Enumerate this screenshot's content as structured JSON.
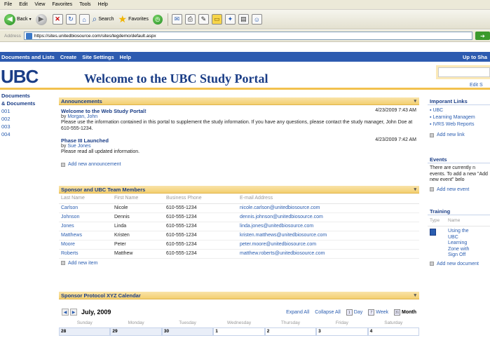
{
  "browser": {
    "menu": [
      "File",
      "Edit",
      "View",
      "Favorites",
      "Tools",
      "Help"
    ],
    "toolbar": {
      "back_label": "Back",
      "search_label": "Search",
      "favorites_label": "Favorites"
    },
    "address_label": "Address",
    "url": "https://sites.unitedbiosource.com/sites/tegdemo/default.aspx"
  },
  "sp_nav": {
    "items": [
      "Documents and Lists",
      "Create",
      "Site Settings",
      "Help"
    ],
    "right": "Up to Sha"
  },
  "header": {
    "logo": "UBC",
    "title": "Welcome to the UBC Study Portal",
    "edit_label": "Edit S"
  },
  "leftnav": {
    "items": [
      "Documents",
      "& Documents",
      "001",
      "002",
      "003",
      "004"
    ]
  },
  "announcements": {
    "title": "Announcements",
    "items": [
      {
        "title": "Welcome to the Web Study Portal!",
        "by_prefix": "by",
        "author": "Morgan, John",
        "date": "4/23/2009 7:43 AM",
        "body": "Please use the information contained in this portal to supplement the study information. If you have any questions, please contact the study manager, John Doe at 610-555-1234."
      },
      {
        "title": "Phase III Launched",
        "by_prefix": "by",
        "author": "Sue Jones",
        "date": "4/23/2009 7:42 AM",
        "body": "Please read all updated information."
      }
    ],
    "add_label": "Add new announcement"
  },
  "team": {
    "title": "Sponsor and UBC Team Members",
    "columns": [
      "Last Name",
      "First Name",
      "Business Phone",
      "E-mail Address"
    ],
    "rows": [
      [
        "Carlson",
        "Nicole",
        "610-555-1234",
        "nicole.carlson@unitedbiosource.com"
      ],
      [
        "Johnson",
        "Dennis",
        "610-555-1234",
        "dennis.johnson@unitedbiosource.com"
      ],
      [
        "Jones",
        "Linda",
        "610-555-1234",
        "linda.jones@unitedbiosource.com"
      ],
      [
        "Matthews",
        "Kristen",
        "610-555-1234",
        "kristen.matthews@unitedbiosource.com"
      ],
      [
        "Moore",
        "Peter",
        "610-555-1234",
        "peter.moore@unitedbiosource.com"
      ],
      [
        "Roberts",
        "Matthew",
        "610-555-1234",
        "matthew.roberts@unitedbiosource.com"
      ]
    ],
    "add_label": "Add new item"
  },
  "calendar": {
    "title": "Sponsor Protocol XYZ Calendar",
    "month": "July, 2009",
    "expand": "Expand All",
    "collapse": "Collapse All",
    "views": [
      "Day",
      "Week",
      "Month"
    ],
    "days": [
      "Sunday",
      "Monday",
      "Tuesday",
      "Wednesday",
      "Thursday",
      "Friday",
      "Saturday"
    ],
    "dates": [
      "28",
      "29",
      "30",
      "1",
      "2",
      "3",
      "4"
    ]
  },
  "important_links": {
    "title": "Imporant Links",
    "items": [
      "UBC",
      "Learning Managem",
      "IVRS Web Reports"
    ],
    "add_label": "Add new link"
  },
  "events": {
    "title": "Events",
    "body": "There are currently n events. To add a new \"Add new event\" belo",
    "add_label": "Add new event"
  },
  "training": {
    "title": "Training",
    "columns": [
      "Type",
      "Name"
    ],
    "item_lines": [
      "Using the",
      "UBC",
      "Learning",
      "Zone with",
      "Sign Off"
    ],
    "add_label": "Add new document"
  }
}
